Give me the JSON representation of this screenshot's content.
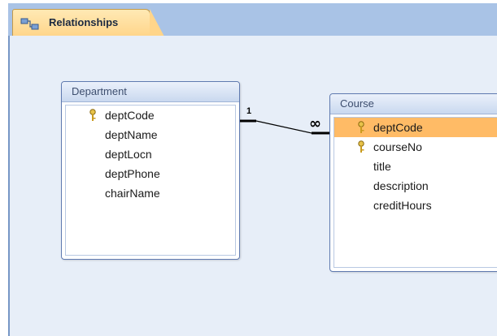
{
  "tab": {
    "label": "Relationships"
  },
  "tables": {
    "department": {
      "title": "Department",
      "fields": [
        {
          "name": "deptCode",
          "key": true
        },
        {
          "name": "deptName",
          "key": false
        },
        {
          "name": "deptLocn",
          "key": false
        },
        {
          "name": "deptPhone",
          "key": false
        },
        {
          "name": "chairName",
          "key": false
        }
      ]
    },
    "course": {
      "title": "Course",
      "fields": [
        {
          "name": "deptCode",
          "key": true,
          "selected": true
        },
        {
          "name": "courseNo",
          "key": true
        },
        {
          "name": "title",
          "key": false
        },
        {
          "name": "description",
          "key": false
        },
        {
          "name": "creditHours",
          "key": false
        }
      ]
    }
  },
  "relationship": {
    "one_label": "1",
    "many_label": "∞"
  },
  "colors": {
    "selected_row": "#ffbb66",
    "key_icon": "#d6a91e",
    "tab": "#ffd58a"
  },
  "icons": {
    "tab": "relationships-icon",
    "key": "primary-key-icon"
  }
}
